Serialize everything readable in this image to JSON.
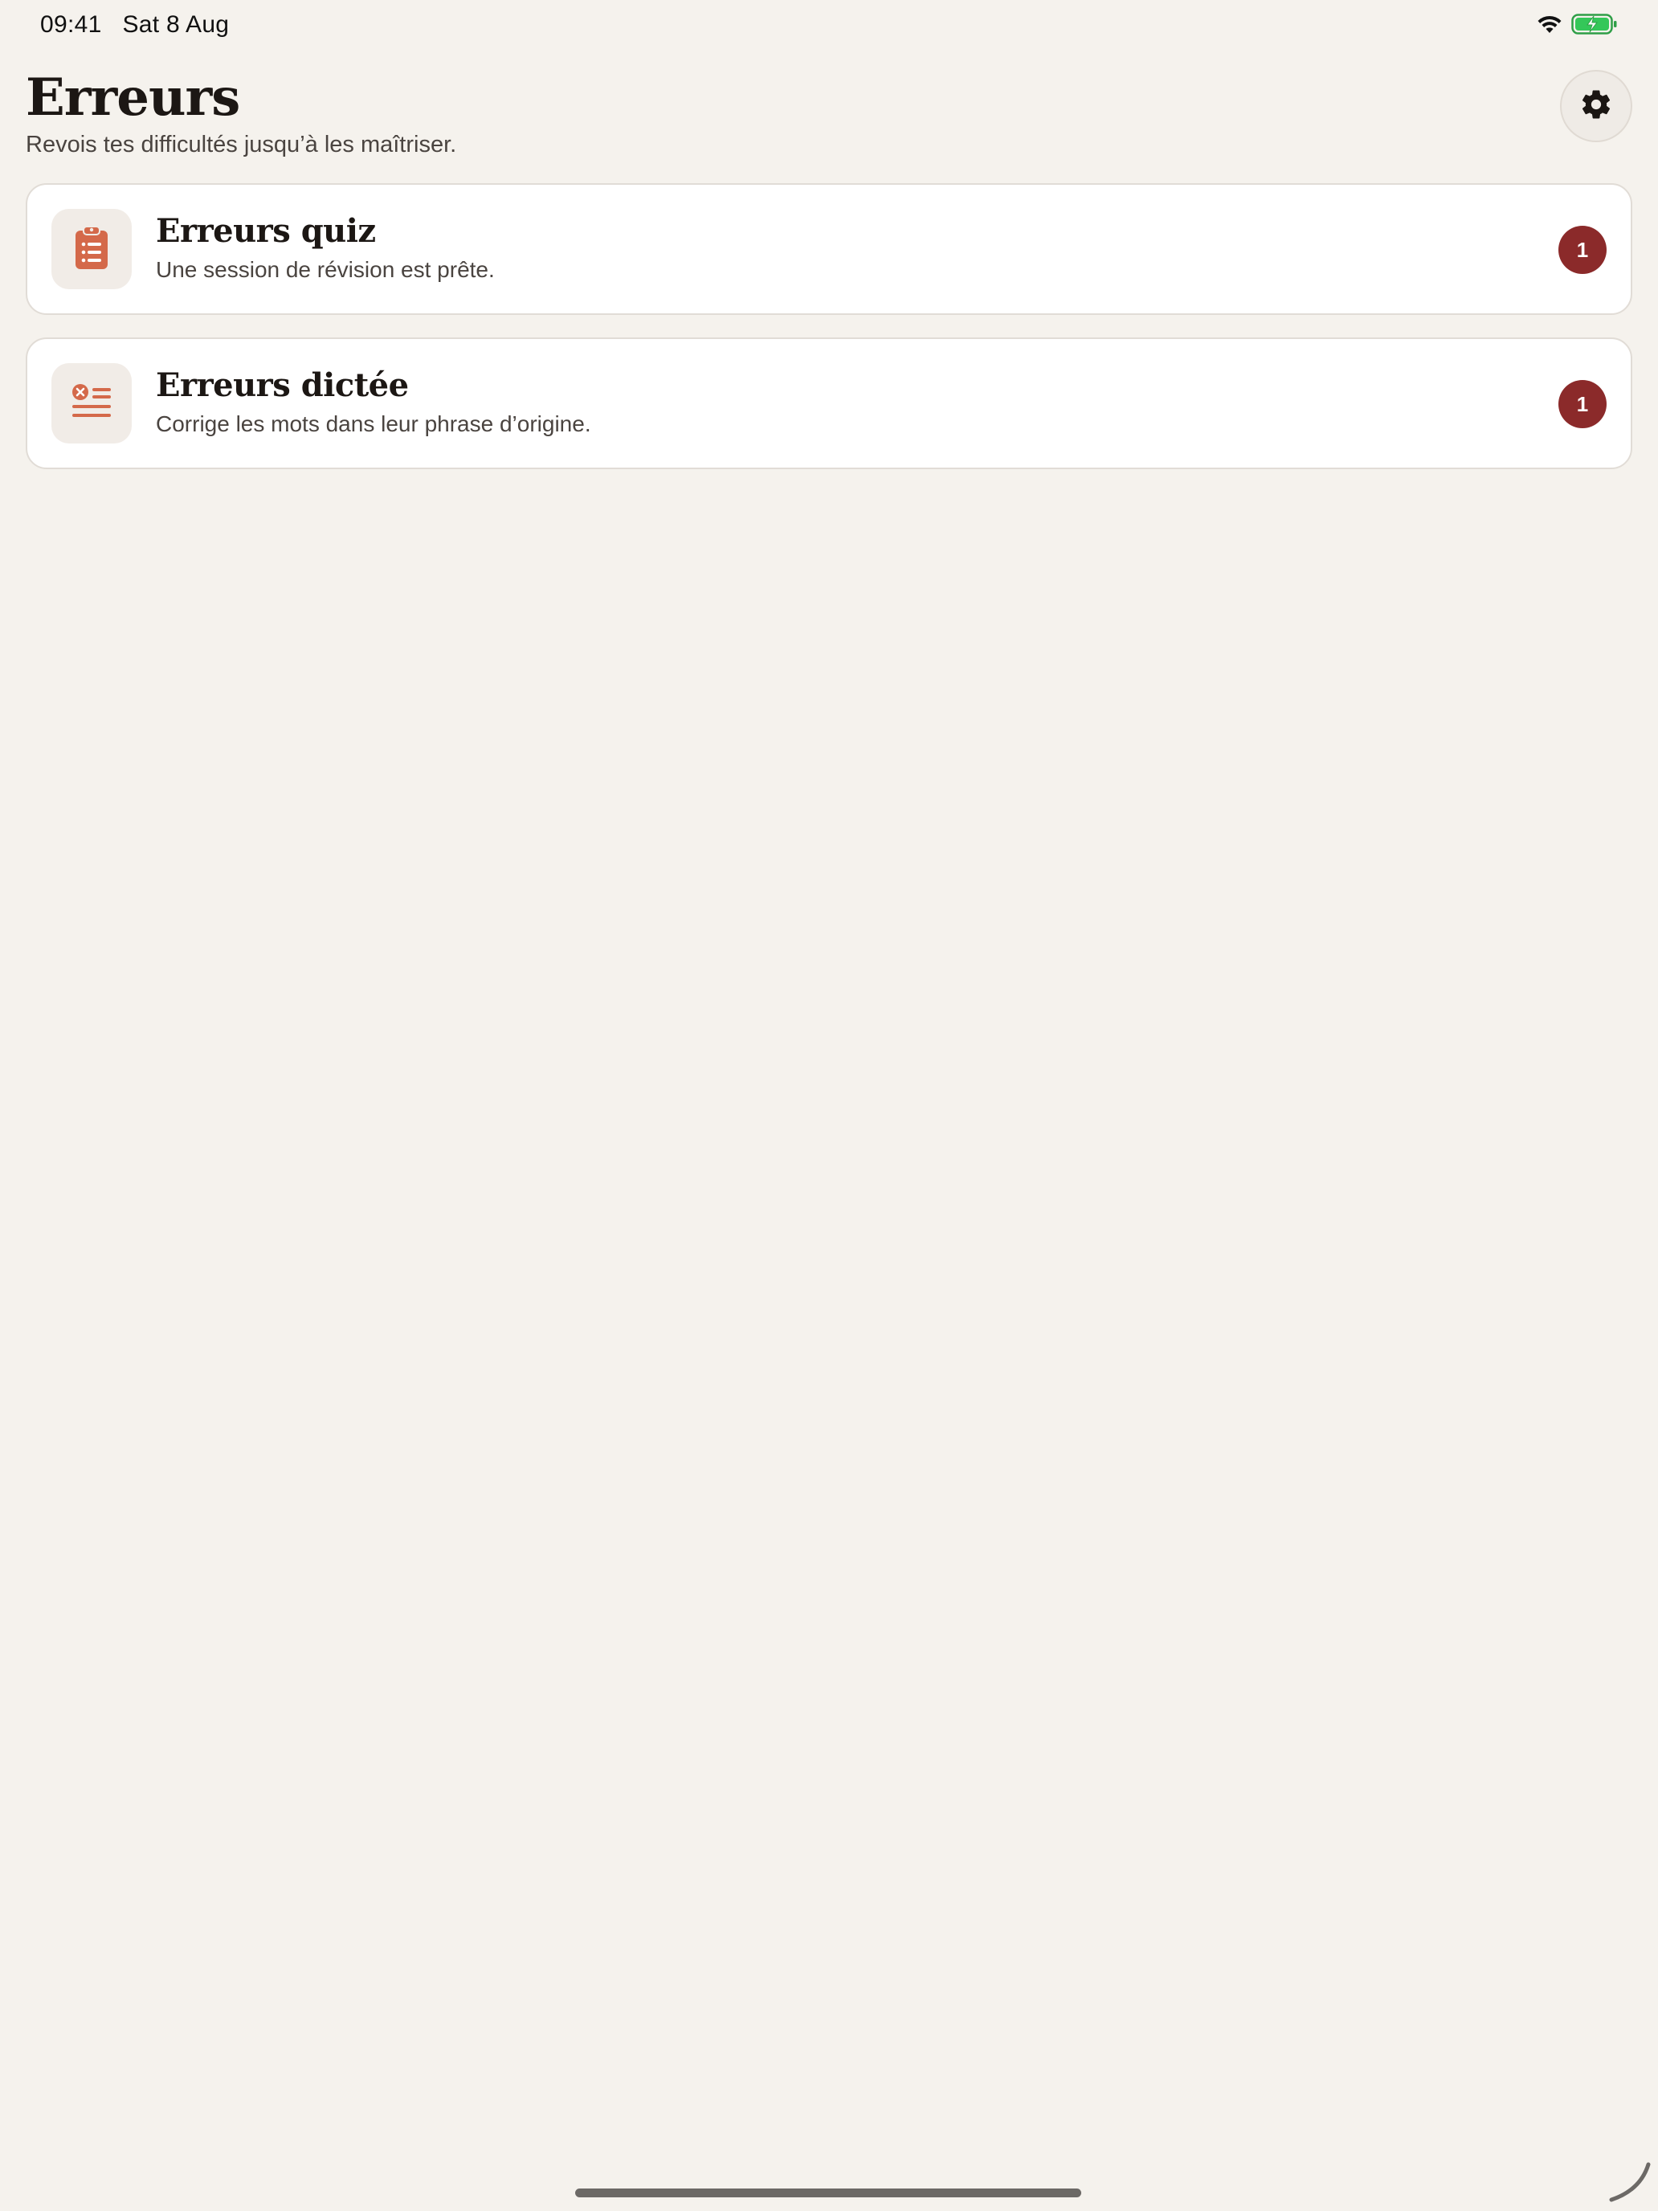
{
  "status_bar": {
    "time": "09:41",
    "date": "Sat 8 Aug",
    "icons": [
      "wifi-icon",
      "battery-charging-icon"
    ],
    "battery_color": "#34c759"
  },
  "header": {
    "title": "Erreurs",
    "subtitle": "Revois tes difficultés jusqu’à les maîtriser.",
    "settings_icon": "gear-icon"
  },
  "cards": [
    {
      "title": "Erreurs quiz",
      "description": "Une session de révision est prête.",
      "badge": "1",
      "icon": "clipboard-list-icon"
    },
    {
      "title": "Erreurs dictée",
      "description": "Corrige les mots dans leur phrase d’origine.",
      "badge": "1",
      "icon": "text-error-icon"
    }
  ],
  "colors": {
    "background": "#f5f2ed",
    "accent": "#d4694a",
    "badge": "#8b2a2a"
  }
}
